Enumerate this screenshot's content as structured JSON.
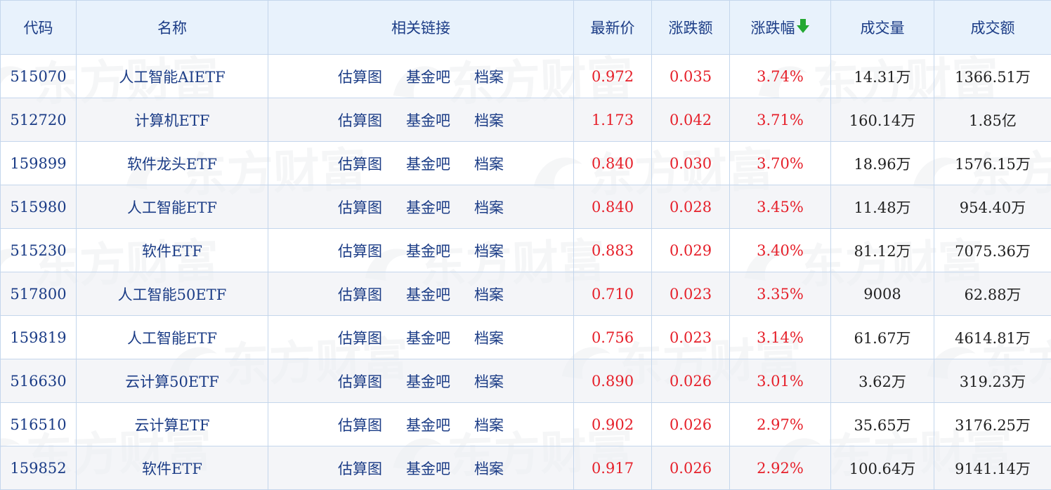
{
  "colors": {
    "header_bg": "#e8f2fc",
    "link": "#1b3c86",
    "up": "#e6202a",
    "sort_arrow": "#23a832",
    "border": "#c4d6ec"
  },
  "watermark": {
    "text": "东方财富",
    "icon": "eastmoney-logo-icon"
  },
  "headers": {
    "code": "代码",
    "name": "名称",
    "links": "相关链接",
    "price": "最新价",
    "change": "涨跌额",
    "change_pct": "涨跌幅",
    "volume": "成交量",
    "turnover": "成交额",
    "sort_icon": "arrow-down-icon"
  },
  "rows": [
    {
      "code": "515070",
      "name": "人工智能AIETF",
      "links": [
        "估算图",
        "基金吧",
        "档案"
      ],
      "price": "0.972",
      "change": "0.035",
      "change_pct": "3.74%",
      "volume": "14.31万",
      "turnover": "1366.51万"
    },
    {
      "code": "512720",
      "name": "计算机ETF",
      "links": [
        "估算图",
        "基金吧",
        "档案"
      ],
      "price": "1.173",
      "change": "0.042",
      "change_pct": "3.71%",
      "volume": "160.14万",
      "turnover": "1.85亿"
    },
    {
      "code": "159899",
      "name": "软件龙头ETF",
      "links": [
        "估算图",
        "基金吧",
        "档案"
      ],
      "price": "0.840",
      "change": "0.030",
      "change_pct": "3.70%",
      "volume": "18.96万",
      "turnover": "1576.15万"
    },
    {
      "code": "515980",
      "name": "人工智能ETF",
      "links": [
        "估算图",
        "基金吧",
        "档案"
      ],
      "price": "0.840",
      "change": "0.028",
      "change_pct": "3.45%",
      "volume": "11.48万",
      "turnover": "954.40万"
    },
    {
      "code": "515230",
      "name": "软件ETF",
      "links": [
        "估算图",
        "基金吧",
        "档案"
      ],
      "price": "0.883",
      "change": "0.029",
      "change_pct": "3.40%",
      "volume": "81.12万",
      "turnover": "7075.36万"
    },
    {
      "code": "517800",
      "name": "人工智能50ETF",
      "links": [
        "估算图",
        "基金吧",
        "档案"
      ],
      "price": "0.710",
      "change": "0.023",
      "change_pct": "3.35%",
      "volume": "9008",
      "turnover": "62.88万"
    },
    {
      "code": "159819",
      "name": "人工智能ETF",
      "links": [
        "估算图",
        "基金吧",
        "档案"
      ],
      "price": "0.756",
      "change": "0.023",
      "change_pct": "3.14%",
      "volume": "61.67万",
      "turnover": "4614.81万"
    },
    {
      "code": "516630",
      "name": "云计算50ETF",
      "links": [
        "估算图",
        "基金吧",
        "档案"
      ],
      "price": "0.890",
      "change": "0.026",
      "change_pct": "3.01%",
      "volume": "3.62万",
      "turnover": "319.23万"
    },
    {
      "code": "516510",
      "name": "云计算ETF",
      "links": [
        "估算图",
        "基金吧",
        "档案"
      ],
      "price": "0.902",
      "change": "0.026",
      "change_pct": "2.97%",
      "volume": "35.65万",
      "turnover": "3176.25万"
    },
    {
      "code": "159852",
      "name": "软件ETF",
      "links": [
        "估算图",
        "基金吧",
        "档案"
      ],
      "price": "0.917",
      "change": "0.026",
      "change_pct": "2.92%",
      "volume": "100.64万",
      "turnover": "9141.14万"
    }
  ]
}
